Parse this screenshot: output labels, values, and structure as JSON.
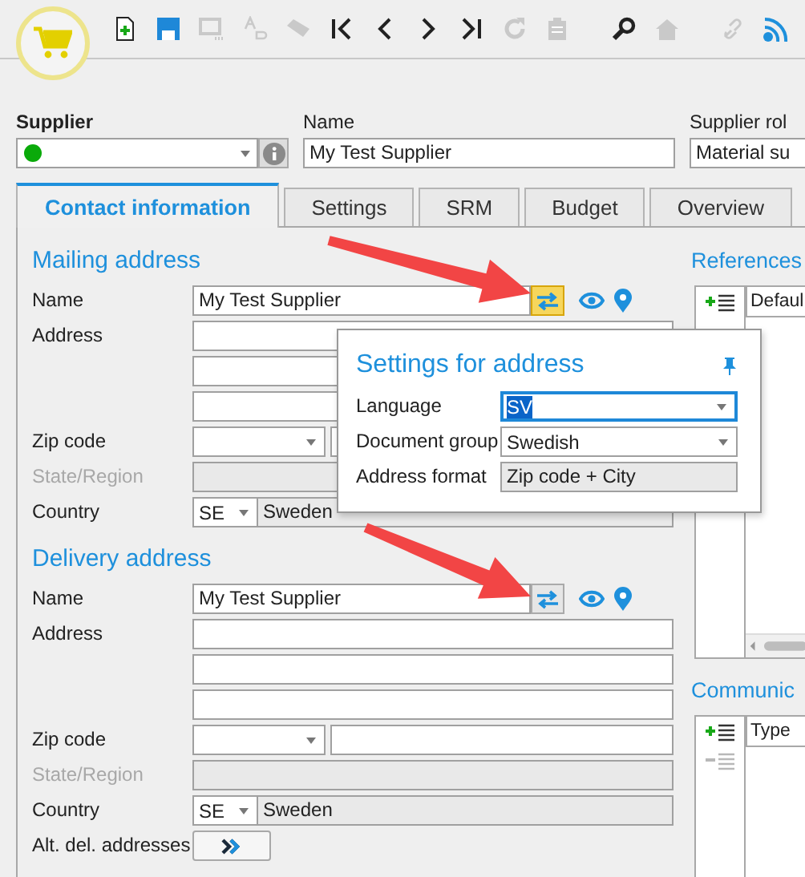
{
  "toolbar": {
    "buttons": [
      {
        "kind": "new",
        "disabled": false
      },
      {
        "kind": "save",
        "disabled": false
      },
      {
        "kind": "form",
        "disabled": true
      },
      {
        "kind": "translate",
        "disabled": true
      },
      {
        "kind": "eraser",
        "disabled": true
      },
      {
        "kind": "first",
        "disabled": false
      },
      {
        "kind": "prev",
        "disabled": false
      },
      {
        "kind": "next",
        "disabled": false
      },
      {
        "kind": "last",
        "disabled": false
      },
      {
        "kind": "refresh",
        "disabled": true
      },
      {
        "kind": "clipboard",
        "disabled": true
      },
      {
        "kind": "search",
        "disabled": false
      },
      {
        "kind": "home",
        "disabled": true
      },
      {
        "kind": "link",
        "disabled": true
      },
      {
        "kind": "feed",
        "disabled": false
      }
    ]
  },
  "header": {
    "supplier_label": "Supplier",
    "name_label": "Name",
    "name_value": "My Test Supplier",
    "role_label": "Supplier rol",
    "role_value": "Material su"
  },
  "tabs": [
    {
      "label": "Contact information",
      "selected": true
    },
    {
      "label": "Settings",
      "selected": false
    },
    {
      "label": "SRM",
      "selected": false
    },
    {
      "label": "Budget",
      "selected": false
    },
    {
      "label": "Overview",
      "selected": false
    }
  ],
  "mailing_address": {
    "title": "Mailing address",
    "rows": [
      {
        "kind": "name",
        "label": "Name",
        "value": "My Test Supplier",
        "settings_active": true
      },
      {
        "kind": "text",
        "label": "Address",
        "disabled": false
      },
      {
        "kind": "text",
        "disabled": false
      },
      {
        "kind": "text",
        "disabled": false
      },
      {
        "kind": "zip",
        "label": "Zip code"
      },
      {
        "kind": "text",
        "label": "State/Region",
        "disabled": true
      },
      {
        "kind": "country",
        "label": "Country",
        "code": "SE",
        "value": "Sweden"
      }
    ]
  },
  "delivery_address": {
    "title": "Delivery address",
    "rows": [
      {
        "kind": "name",
        "label": "Name",
        "value": "My Test Supplier",
        "settings_active": false
      },
      {
        "kind": "text",
        "label": "Address",
        "disabled": false
      },
      {
        "kind": "text",
        "disabled": false
      },
      {
        "kind": "text",
        "disabled": false
      },
      {
        "kind": "zip",
        "label": "Zip code"
      },
      {
        "kind": "text",
        "label": "State/Region",
        "disabled": true
      },
      {
        "kind": "country",
        "label": "Country",
        "code": "SE",
        "value": "Sweden"
      },
      {
        "kind": "button",
        "label": "Alt. del. addresses"
      }
    ]
  },
  "references": {
    "title": "References",
    "actions": [
      {
        "kind": "add",
        "disabled": false
      }
    ],
    "columns": [
      "Defaul"
    ]
  },
  "communication": {
    "title": "Communic",
    "actions": [
      {
        "kind": "add",
        "disabled": false
      },
      {
        "kind": "remove",
        "disabled": true
      }
    ],
    "columns": [
      "Type"
    ]
  },
  "address_settings": {
    "title": "Settings for address",
    "fields": [
      {
        "kind": "select",
        "label": "Language",
        "value": "SV",
        "focused": true
      },
      {
        "kind": "select",
        "label": "Document group",
        "value": "Swedish",
        "focused": false
      },
      {
        "kind": "readonly",
        "label": "Address format",
        "value": "Zip code + City"
      }
    ]
  }
}
